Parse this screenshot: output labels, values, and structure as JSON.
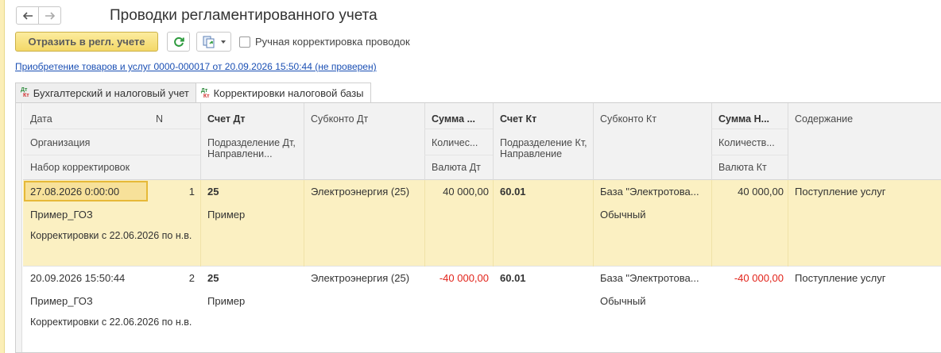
{
  "window": {
    "title": "Проводки регламентированного учета"
  },
  "toolbar": {
    "post_label": "Отразить в регл. учете",
    "manual_edit_label": "Ручная корректировка проводок",
    "manual_edit_checked": false
  },
  "document_link": "Приобретение товаров и услуг 0000-000017 от 20.09.2026 15:50:44 (не проверен)",
  "tabs": [
    {
      "label": "Бухгалтерский и налоговый учет",
      "icon": "dt-kt-icon",
      "active": false
    },
    {
      "label": "Корректировки налоговой базы",
      "icon": "dt-kt-icon",
      "active": true
    }
  ],
  "icon_labels": {
    "dt": "Дт",
    "kt": "Кт"
  },
  "columns": {
    "date": "Дата",
    "n": "N",
    "account_dt": "Счет Дт",
    "subconto_dt": "Субконто Дт",
    "sum_dt": "Сумма ...",
    "account_kt": "Счет Кт",
    "subconto_kt": "Субконто Кт",
    "sum_kt": "Сумма Н...",
    "content": "Содержание",
    "organization": "Организация",
    "subdivision_dt": "Подразделение Дт, Направлени...",
    "quantity_dt": "Количес...",
    "subdivision_kt": "Подразделение Кт, Направление",
    "quantity_kt": "Количеств...",
    "adjustment_set": "Набор корректировок",
    "currency_dt": "Валюта Дт",
    "currency_kt": "Валюта Кт"
  },
  "rows": [
    {
      "selected": true,
      "date": "27.08.2026 0:00:00",
      "n": "1",
      "account_dt": "25",
      "subconto_dt": "Электроэнергия (25)",
      "sum_dt": "40 000,00",
      "account_kt": "60.01",
      "subconto_kt": "База \"Электротова...",
      "sum_kt": "40 000,00",
      "content": "Поступление услуг",
      "organization": "Пример_ГОЗ",
      "subdivision_dt": "Пример",
      "subconto_kt_2": "Обычный",
      "adjustment_set": "Корректировки с 22.06.2026 по н.в."
    },
    {
      "selected": false,
      "date": "20.09.2026 15:50:44",
      "n": "2",
      "account_dt": "25",
      "subconto_dt": "Электроэнергия (25)",
      "sum_dt": "-40 000,00",
      "account_kt": "60.01",
      "subconto_kt": "База \"Электротова...",
      "sum_kt": "-40 000,00",
      "content": "Поступление услуг",
      "organization": "Пример_ГОЗ",
      "subdivision_dt": "Пример",
      "subconto_kt_2": "Обычный",
      "adjustment_set": "Корректировки с 22.06.2026 по н.в."
    }
  ]
}
